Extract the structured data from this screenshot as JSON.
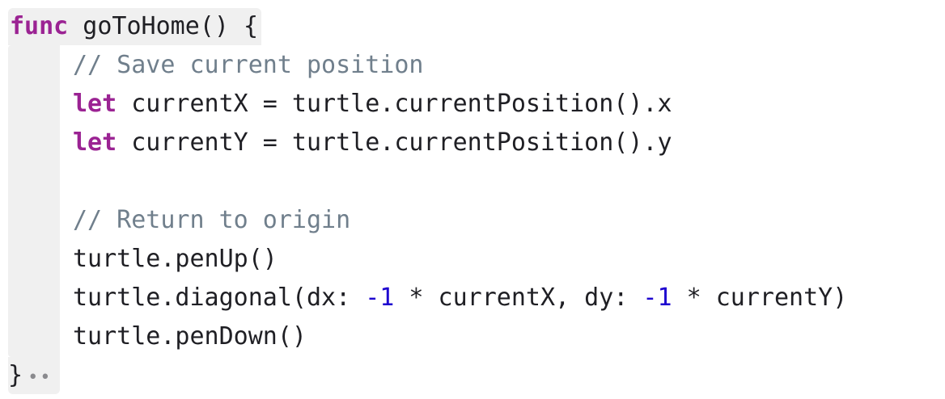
{
  "editor": {
    "header": {
      "keyword": "func",
      "signature": " goToHome() {"
    },
    "lines": [
      {
        "type": "comment",
        "text": "// Save current position"
      },
      {
        "type": "let",
        "keyword": "let",
        "text": " currentX = turtle.currentPosition().x"
      },
      {
        "type": "let",
        "keyword": "let",
        "text": " currentY = turtle.currentPosition().y"
      },
      {
        "type": "comment",
        "text": "// Return to origin"
      },
      {
        "type": "plain",
        "text": "turtle.penUp()"
      },
      {
        "type": "diagonal",
        "part1": "turtle.diagonal(dx: ",
        "num1": "-1",
        "part2": " * currentX, dy: ",
        "num2": "-1",
        "part3": " * currentY)"
      },
      {
        "type": "plain",
        "text": "turtle.penDown()"
      }
    ],
    "footer": {
      "brace": "}",
      "fold_indicator": "••"
    }
  },
  "colors": {
    "keyword": "#9b2393",
    "comment": "#707f8c",
    "number": "#1c00cf",
    "text": "#1f1f24",
    "block_highlight": "#f0f0f0"
  }
}
